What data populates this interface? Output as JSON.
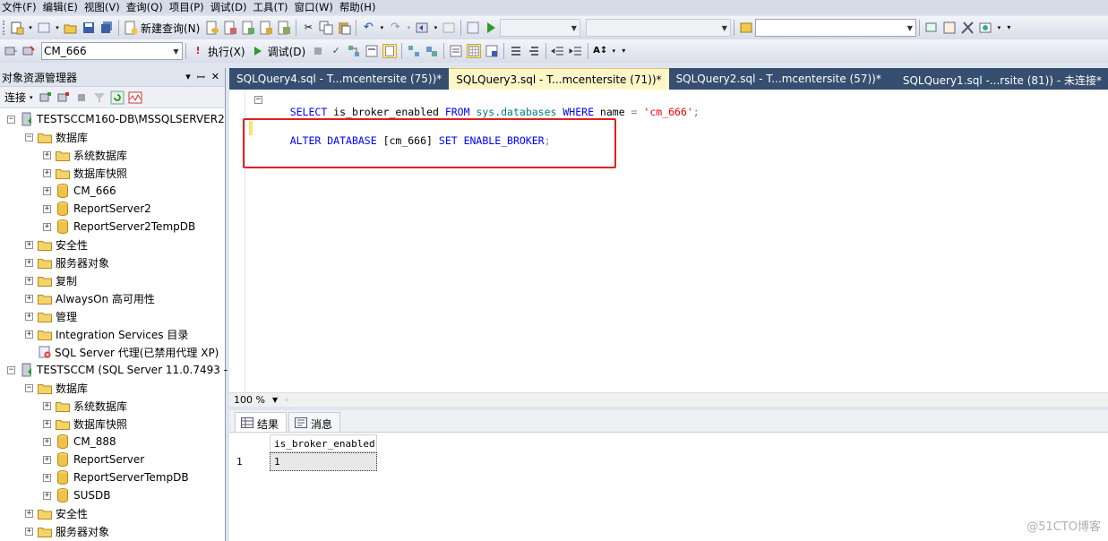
{
  "menu": [
    "文件(F)",
    "编辑(E)",
    "视图(V)",
    "查询(Q)",
    "项目(P)",
    "调试(D)",
    "工具(T)",
    "窗口(W)",
    "帮助(H)"
  ],
  "toolbar1": {
    "new_query_label": "新建查询(N)",
    "search_value": ""
  },
  "toolbar2": {
    "database_value": "CM_666",
    "execute_label": "执行(X)",
    "debug_label": "调试(D)"
  },
  "object_explorer": {
    "title": "对象资源管理器",
    "connect_label": "连接",
    "nodes": [
      {
        "label": "TESTSCCM160-DB\\MSSQLSERVER2",
        "expander": "⊟"
      },
      {
        "label": "数据库",
        "expander": "⊟"
      },
      {
        "label": "系统数据库",
        "expander": "⊞"
      },
      {
        "label": "数据库快照",
        "expander": "⊞"
      },
      {
        "label": "CM_666",
        "expander": "⊞"
      },
      {
        "label": "ReportServer2",
        "expander": "⊞"
      },
      {
        "label": "ReportServer2TempDB",
        "expander": "⊞"
      },
      {
        "label": "安全性",
        "expander": "⊞"
      },
      {
        "label": "服务器对象",
        "expander": "⊞"
      },
      {
        "label": "复制",
        "expander": "⊞"
      },
      {
        "label": "AlwaysOn 高可用性",
        "expander": "⊞"
      },
      {
        "label": "管理",
        "expander": "⊞"
      },
      {
        "label": "Integration Services 目录",
        "expander": "⊞"
      },
      {
        "label": "SQL Server 代理(已禁用代理 XP)",
        "expander": ""
      },
      {
        "label": "TESTSCCM (SQL Server 11.0.7493 -",
        "expander": "⊟"
      },
      {
        "label": "数据库",
        "expander": "⊟"
      },
      {
        "label": "系统数据库",
        "expander": "⊞"
      },
      {
        "label": "数据库快照",
        "expander": "⊞"
      },
      {
        "label": "CM_888",
        "expander": "⊞"
      },
      {
        "label": "ReportServer",
        "expander": "⊞"
      },
      {
        "label": "ReportServerTempDB",
        "expander": "⊞"
      },
      {
        "label": "SUSDB",
        "expander": "⊞"
      },
      {
        "label": "安全性",
        "expander": "⊞"
      },
      {
        "label": "服务器对象",
        "expander": "⊞"
      }
    ]
  },
  "tabs": [
    {
      "label": "SQLQuery4.sql - T...mcentersite (75))*",
      "active": false
    },
    {
      "label": "SQLQuery3.sql - T...mcentersite (71))*",
      "active": true
    },
    {
      "label": "SQLQuery2.sql - T...mcentersite (57))*",
      "active": false
    },
    {
      "label": "SQLQuery1.sql -...rsite (81)) - 未连接*",
      "active": false
    }
  ],
  "editor": {
    "line1": {
      "select": "SELECT",
      "col": " is_broker_enabled ",
      "from": "FROM",
      "sysdb": " sys.databases ",
      "where": "WHERE",
      "name": " name ",
      "eq": "=",
      "str": " 'cm_666'",
      "semi": ";"
    },
    "line2": {
      "alter": "ALTER DATABASE",
      "db": " [cm_666] ",
      "set": "SET ENABLE_BROKER",
      "semi": ";"
    }
  },
  "zoom": "100 %",
  "results_tabs": {
    "results_label": "结果",
    "messages_label": "消息"
  },
  "grid": {
    "column": "is_broker_enabled",
    "row_number": "1",
    "value": "1"
  },
  "watermark": "@51CTO博客",
  "colors": {
    "tab_bar": "#364e6f",
    "active_tab": "#fff6c8",
    "keyword": "#0000ff",
    "string": "#ff0000",
    "highlight_box": "#e02020"
  }
}
